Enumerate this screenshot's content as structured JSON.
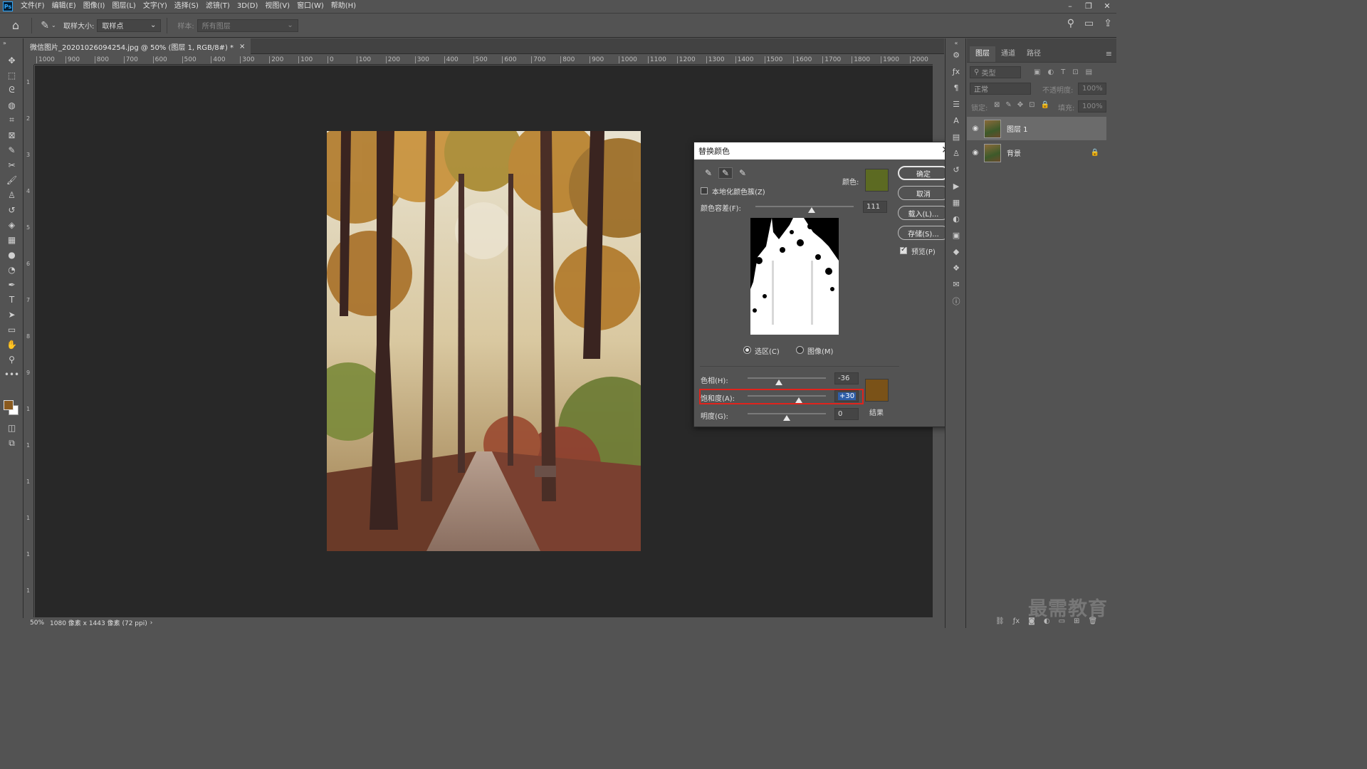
{
  "app": {
    "logo_text": "Ps"
  },
  "menu": [
    "文件(F)",
    "编辑(E)",
    "图像(I)",
    "图层(L)",
    "文字(Y)",
    "选择(S)",
    "滤镜(T)",
    "3D(D)",
    "视图(V)",
    "窗口(W)",
    "帮助(H)"
  ],
  "window_controls": [
    "–",
    "❐",
    "✕"
  ],
  "options_bar": {
    "sample_size_label": "取样大小:",
    "sample_size_value": "取样点",
    "sample_label": "样本:",
    "sample_value": "所有图层"
  },
  "document": {
    "tab_title": "微信图片_20201026094254.jpg @ 50% (图层 1, RGB/8#) *",
    "tab_close": "×",
    "ruler_ticks": [
      "1000",
      "900",
      "800",
      "700",
      "600",
      "500",
      "400",
      "300",
      "200",
      "100",
      "0",
      "100",
      "200",
      "300",
      "400",
      "500",
      "600",
      "700",
      "800",
      "900",
      "1000",
      "1100",
      "1200",
      "1300",
      "1400",
      "1500",
      "1600",
      "1700",
      "1800",
      "1900",
      "2000"
    ],
    "ruler_left_ticks": [
      "1",
      "2",
      "3",
      "4",
      "5",
      "6",
      "7",
      "8",
      "9",
      "1",
      "1",
      "1",
      "1",
      "1",
      "1"
    ],
    "status_zoom": "50%",
    "status_info": "1080 像素 x 1443 像素 (72 ppi)"
  },
  "dialog": {
    "title": "替换颜色",
    "localized_clusters_label": "本地化颜色簇(Z)",
    "color_label": "颜色:",
    "fuzziness_label": "颜色容差(F):",
    "fuzziness_value": "111",
    "fuzziness_fraction": 0.57,
    "selection_label": "选区(C)",
    "image_label": "图像(M)",
    "hue_label": "色相(H):",
    "hue_value": "-36",
    "hue_fraction": 0.4,
    "saturation_label": "饱和度(A):",
    "saturation_value": "+30",
    "saturation_fraction": 0.65,
    "lightness_label": "明度(G):",
    "lightness_value": "0",
    "lightness_fraction": 0.5,
    "result_label": "结果",
    "ok_label": "确定",
    "cancel_label": "取消",
    "load_label": "载入(L)...",
    "save_label": "存储(S)...",
    "preview_label": "预览(P)",
    "sample_color": "#5c6a22",
    "result_color": "#7a5218"
  },
  "layers_panel": {
    "tabs": [
      "图层",
      "通道",
      "路径"
    ],
    "filter_placeholder": "类型",
    "blend_mode": "正常",
    "opacity_label": "不透明度:",
    "opacity_value": "100%",
    "lock_label": "锁定:",
    "fill_label": "填充:",
    "fill_value": "100%",
    "layers": [
      {
        "name": "图层 1"
      },
      {
        "name": "背景"
      }
    ]
  },
  "watermark": "最需教育",
  "colors": {
    "foreground": "#8a5a1e",
    "background": "#ffffff",
    "highlight": "#e0231c"
  }
}
